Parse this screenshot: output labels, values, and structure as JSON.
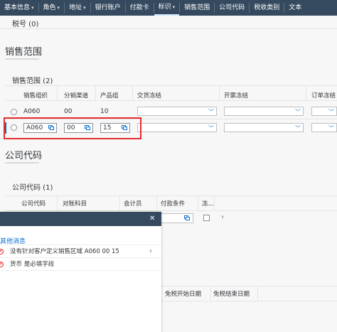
{
  "tabs": [
    {
      "label": "基本信息",
      "chevron": true
    },
    {
      "label": "角色",
      "chevron": true
    },
    {
      "label": "地址",
      "chevron": true
    },
    {
      "label": "银行账户",
      "chevron": false
    },
    {
      "label": "付款卡",
      "chevron": false
    },
    {
      "label": "标识",
      "chevron": true
    },
    {
      "label": "销售范围",
      "chevron": false
    },
    {
      "label": "公司代码",
      "chevron": false
    },
    {
      "label": "税收类别",
      "chevron": false
    },
    {
      "label": "文本",
      "chevron": false
    }
  ],
  "tax_number_title": "税号 (0)",
  "sales_area": {
    "section_title": "销售范围",
    "table_title": "销售范围 (2)",
    "columns": [
      "销售组织",
      "分销渠道",
      "产品组",
      "交货冻结",
      "开票冻结",
      "订单冻结"
    ],
    "row1": {
      "sales_org": "A060",
      "channel": "00",
      "division": "10"
    },
    "row2": {
      "sales_org": "A060",
      "channel": "00",
      "division": "15"
    }
  },
  "company_code": {
    "section_title": "公司代码",
    "table_title": "公司代码 (1)",
    "columns": [
      "公司代码",
      "对账科目",
      "会计员",
      "付款条件",
      "冻..."
    ]
  },
  "tax_exempt_columns": [
    "免税开始日期",
    "免税结束日期"
  ],
  "dialog": {
    "group_title": "其他消息",
    "messages": [
      "没有针对客户定义销售区域 A060 00 15",
      "货币 是必填字段"
    ],
    "close_glyph": "✕"
  },
  "colors": {
    "shell": "#354a5f",
    "error": "#e52d2d",
    "accent": "#0a6ed1"
  }
}
